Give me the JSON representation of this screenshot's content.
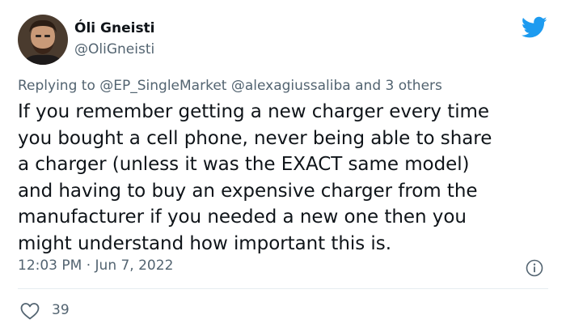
{
  "author": {
    "display_name": "Óli Gneisti",
    "handle": "@OliGneisti",
    "avatar_icon": "user-avatar"
  },
  "brand": {
    "logo_icon": "twitter-bird-icon",
    "accent": "#1d9bf0"
  },
  "reply": {
    "prefix": "Replying to",
    "mentions": [
      "@EP_SingleMarket",
      "@alexagiussaliba"
    ],
    "suffix": "and 3 others"
  },
  "tweet": {
    "lines": [
      "If you remember getting a new charger every time",
      "you bought a cell phone, never being able to share",
      "a charger (unless it was the EXACT same model)",
      "and having to buy an expensive charger from the",
      "manufacturer if you needed a new one then you",
      "might understand how important this is."
    ],
    "timestamp": "12:03 PM · Jun 7, 2022"
  },
  "actions": {
    "like_icon": "heart-icon",
    "like_count": "39",
    "info_icon": "info-icon"
  }
}
